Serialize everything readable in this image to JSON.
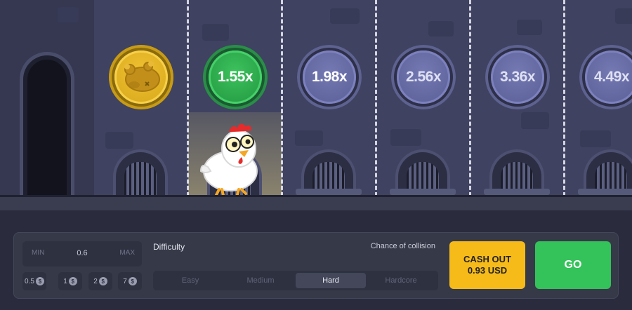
{
  "multipliers": [
    "1.55x",
    "1.98x",
    "2.56x",
    "3.36x",
    "4.49x"
  ],
  "bet": {
    "min_label": "MIN",
    "value": "0.6",
    "max_label": "MAX"
  },
  "quick_bets": [
    {
      "label": "0.5",
      "icon": "dollar-coin-icon"
    },
    {
      "label": "1",
      "icon": "dollar-coin-icon"
    },
    {
      "label": "2",
      "icon": "dollar-coin-icon"
    },
    {
      "label": "7",
      "icon": "dollar-coin-icon"
    }
  ],
  "difficulty": {
    "label": "Difficulty",
    "collision_label": "Chance of collision",
    "options": [
      "Easy",
      "Medium",
      "Hard",
      "Hardcore"
    ],
    "selected": "Hard"
  },
  "actions": {
    "cashout_label": "CASH OUT",
    "cashout_amount": "0.93 USD",
    "go_label": "GO"
  },
  "colors": {
    "cashout": "#f7bb19",
    "go": "#34c25a",
    "current_multiplier": "#2fb04e",
    "collected_coin": "#e6b422",
    "pending_multiplier": "#6368a4"
  }
}
